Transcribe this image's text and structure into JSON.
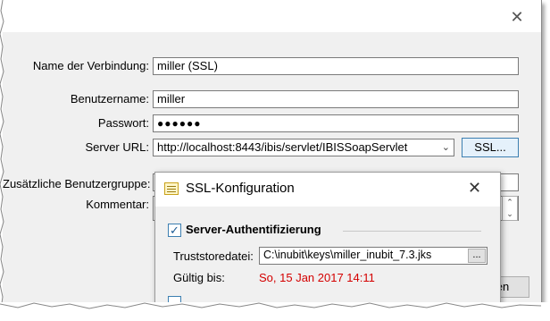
{
  "main": {
    "labels": {
      "name": "Name der Verbindung:",
      "user": "Benutzername:",
      "password": "Passwort:",
      "server_url": "Server URL:",
      "extra_group": "Zusätzliche Benutzergruppe:",
      "comment": "Kommentar:"
    },
    "values": {
      "name": "miller (SSL)",
      "user": "miller",
      "password": "●●●●●●",
      "server_url": "http://localhost:8443/ibis/servlet/IBISSoapServlet"
    },
    "ssl_button": "SSL...",
    "bottom_button_partial": "chen"
  },
  "ssl_dialog": {
    "title": "SSL-Konfiguration",
    "server_auth_label": "Server-Authentifizierung",
    "server_auth_checked": true,
    "truststore_label": "Truststoredatei:",
    "truststore_value": "C:\\inubit\\keys\\miller_inubit_7.3.jks",
    "browse_label": "...",
    "valid_label": "Gültig bis:",
    "valid_value": "So, 15 Jan 2017 14:11",
    "valid_color": "#d40000"
  }
}
